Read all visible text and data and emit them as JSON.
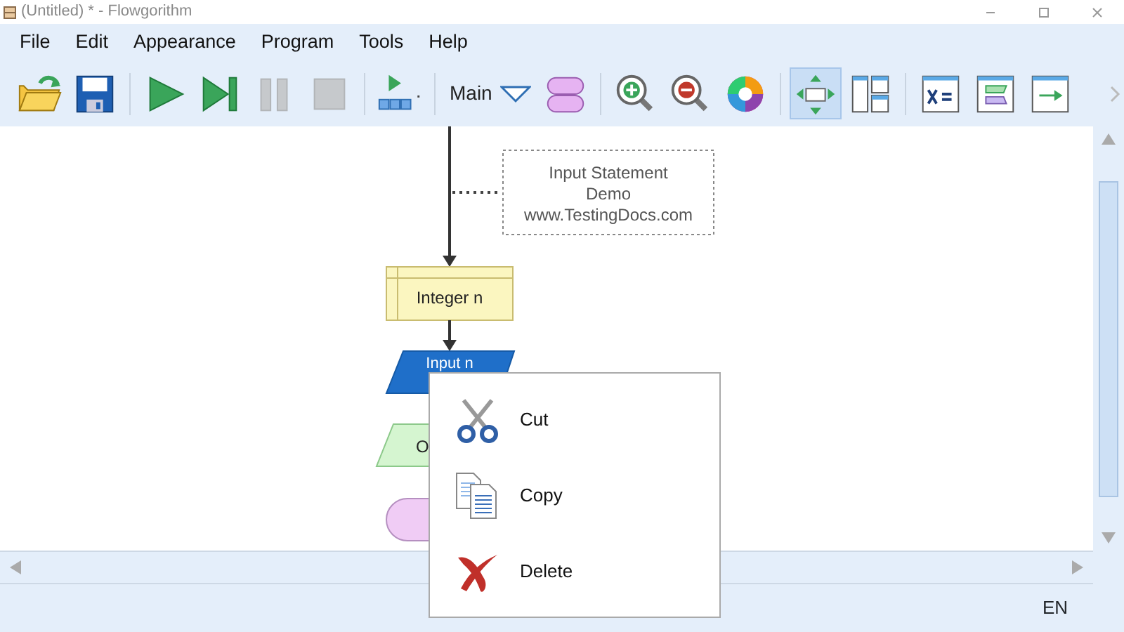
{
  "window": {
    "title": "(Untitled) * - Flowgorithm"
  },
  "menu": [
    "File",
    "Edit",
    "Appearance",
    "Program",
    "Tools",
    "Help"
  ],
  "toolbar": {
    "groups": [
      [
        {
          "kind": "open",
          "selected": false,
          "disabled": false
        },
        {
          "kind": "save",
          "selected": false,
          "disabled": false
        }
      ],
      [
        {
          "kind": "run",
          "selected": false,
          "disabled": false
        },
        {
          "kind": "step",
          "selected": false,
          "disabled": false
        },
        {
          "kind": "pause",
          "selected": false,
          "disabled": true
        },
        {
          "kind": "stop",
          "selected": false,
          "disabled": true
        }
      ],
      [
        {
          "kind": "speed",
          "selected": false,
          "disabled": false
        }
      ],
      [
        {
          "kind": "function",
          "label": "Main",
          "selected": false,
          "disabled": false
        },
        {
          "kind": "functions",
          "selected": false,
          "disabled": false
        }
      ],
      [
        {
          "kind": "zoom-in",
          "selected": false,
          "disabled": false
        },
        {
          "kind": "zoom-out",
          "selected": false,
          "disabled": false
        },
        {
          "kind": "colors",
          "selected": false,
          "disabled": false
        }
      ],
      [
        {
          "kind": "flowchart",
          "selected": true,
          "disabled": false
        },
        {
          "kind": "layout",
          "selected": false,
          "disabled": false
        }
      ],
      [
        {
          "kind": "variables",
          "selected": false,
          "disabled": false
        },
        {
          "kind": "source",
          "selected": false,
          "disabled": false
        },
        {
          "kind": "console",
          "selected": false,
          "disabled": false
        }
      ]
    ]
  },
  "flowchart": {
    "comment": [
      "Input Statement",
      "Demo",
      "www.TestingDocs.com"
    ],
    "blocks": [
      {
        "kind": "declare",
        "text": "Integer n"
      },
      {
        "kind": "input",
        "text": "Input n"
      },
      {
        "kind": "output",
        "text": "O"
      },
      {
        "kind": "end"
      }
    ]
  },
  "context_menu": [
    {
      "kind": "cut",
      "label": "Cut"
    },
    {
      "kind": "copy",
      "label": "Copy"
    },
    {
      "kind": "delete",
      "label": "Delete"
    }
  ],
  "status_bar": {
    "language": "EN"
  }
}
